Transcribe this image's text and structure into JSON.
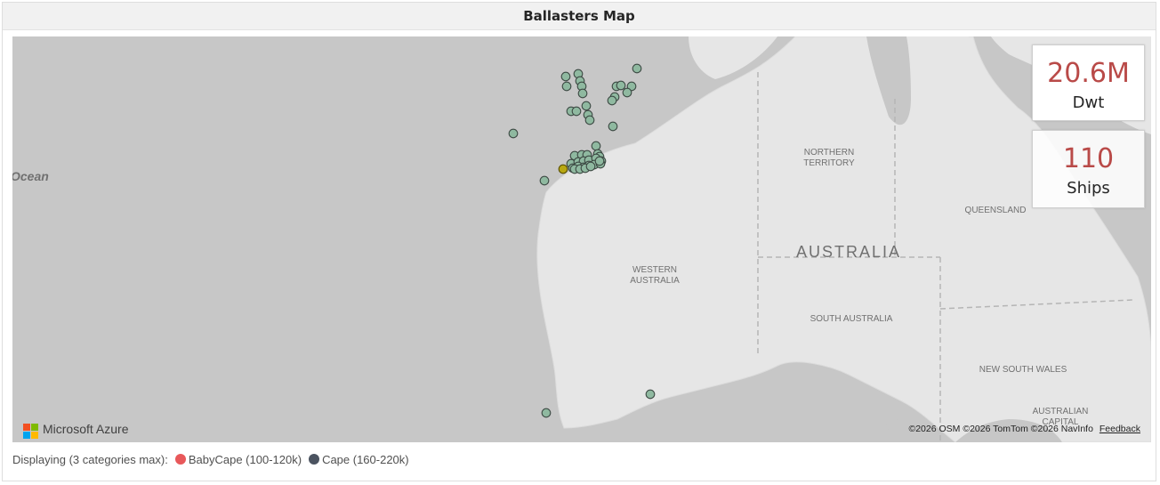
{
  "title": "Ballasters Map",
  "kpis": [
    {
      "value": "20.6M",
      "label": "Dwt"
    },
    {
      "value": "110",
      "label": "Ships"
    }
  ],
  "map_labels": {
    "ocean": "Ocean",
    "northern_territory_1": "NORTHERN",
    "northern_territory_2": "TERRITORY",
    "queensland": "QUEENSLAND",
    "australia": "AUSTRALIA",
    "western_australia_1": "WESTERN",
    "western_australia_2": "AUSTRALIA",
    "south_australia": "SOUTH AUSTRALIA",
    "new_south_wales": "NEW SOUTH WALES",
    "act_1": "AUSTRALIAN",
    "act_2": "CAPITAL"
  },
  "provider": "Microsoft Azure",
  "attribution": {
    "text": "©2026 OSM  ©2026 TomTom  ©2026 NavInfo",
    "feedback": "Feedback"
  },
  "legend": {
    "prefix": "Displaying (3 categories max):",
    "items": [
      {
        "label": "BabyCape (100-120k)",
        "color": "#e8585a"
      },
      {
        "label": "Cape (160-220k)",
        "color": "#4b5360"
      }
    ]
  },
  "colors": {
    "point_fill": "#8fb9a0",
    "point_stroke": "#3d4a44",
    "highlight_fill": "#b8a812",
    "kpi_value": "#b94a48"
  }
}
